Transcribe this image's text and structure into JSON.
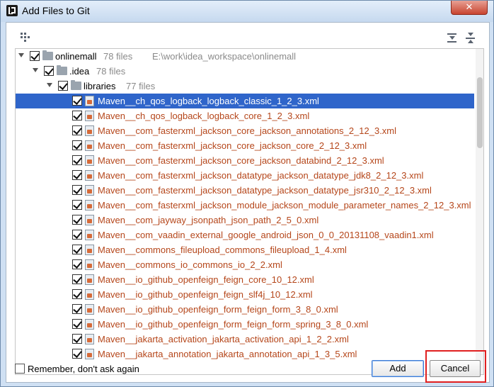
{
  "window": {
    "title": "Add Files to Git",
    "close_label": "✕"
  },
  "tree": {
    "root": {
      "label": "onlinemall",
      "count": "78 files",
      "path": "E:\\work\\idea_workspace\\onlinemall"
    },
    "idea": {
      "label": ".idea",
      "count": "78 files"
    },
    "libraries": {
      "label": "libraries",
      "count": "77 files"
    },
    "files": [
      "Maven__ch_qos_logback_logback_classic_1_2_3.xml",
      "Maven__ch_qos_logback_logback_core_1_2_3.xml",
      "Maven__com_fasterxml_jackson_core_jackson_annotations_2_12_3.xml",
      "Maven__com_fasterxml_jackson_core_jackson_core_2_12_3.xml",
      "Maven__com_fasterxml_jackson_core_jackson_databind_2_12_3.xml",
      "Maven__com_fasterxml_jackson_datatype_jackson_datatype_jdk8_2_12_3.xml",
      "Maven__com_fasterxml_jackson_datatype_jackson_datatype_jsr310_2_12_3.xml",
      "Maven__com_fasterxml_jackson_module_jackson_module_parameter_names_2_12_3.xml",
      "Maven__com_jayway_jsonpath_json_path_2_5_0.xml",
      "Maven__com_vaadin_external_google_android_json_0_0_20131108_vaadin1.xml",
      "Maven__commons_fileupload_commons_fileupload_1_4.xml",
      "Maven__commons_io_commons_io_2_2.xml",
      "Maven__io_github_openfeign_feign_core_10_12.xml",
      "Maven__io_github_openfeign_feign_slf4j_10_12.xml",
      "Maven__io_github_openfeign_form_feign_form_3_8_0.xml",
      "Maven__io_github_openfeign_form_feign_form_spring_3_8_0.xml",
      "Maven__jakarta_activation_jakarta_activation_api_1_2_2.xml",
      "Maven__jakarta_annotation_jakarta_annotation_api_1_3_5.xml"
    ],
    "selected_index": 0
  },
  "footer": {
    "remember_label": "Remember, don't ask again",
    "add_label": "Add",
    "cancel_label": "Cancel"
  },
  "colors": {
    "selection": "#2f65ca",
    "file_text": "#b5461a",
    "highlight_box": "#e02020"
  }
}
